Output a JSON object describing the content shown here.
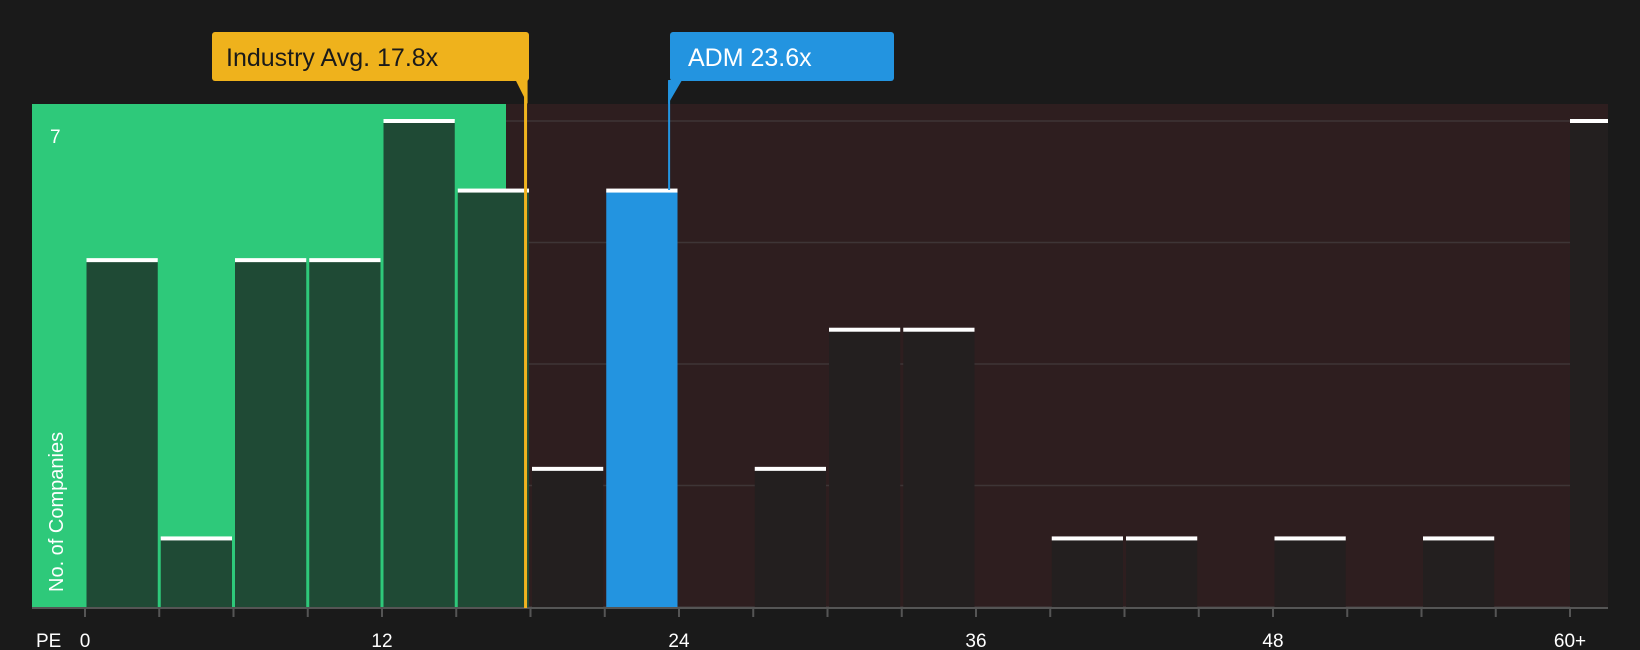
{
  "chart_data": {
    "type": "bar",
    "x_axis_label": "PE",
    "y_axis_label": "No. of Companies",
    "y_tick_label": "7",
    "ylim": [
      0,
      7
    ],
    "bin_width": 3,
    "xlim": [
      0,
      60
    ],
    "x_tick_values": [
      0,
      12,
      24,
      36,
      48
    ],
    "x_tick_labels": [
      "0",
      "12",
      "24",
      "36",
      "48",
      "60+"
    ],
    "bins": [
      {
        "start": 0,
        "value": 5
      },
      {
        "start": 3,
        "value": 1
      },
      {
        "start": 6,
        "value": 5
      },
      {
        "start": 9,
        "value": 5
      },
      {
        "start": 12,
        "value": 7
      },
      {
        "start": 15,
        "value": 6
      },
      {
        "start": 18,
        "value": 2
      },
      {
        "start": 21,
        "value": 6,
        "highlight": true
      },
      {
        "start": 24,
        "value": 0
      },
      {
        "start": 27,
        "value": 2
      },
      {
        "start": 30,
        "value": 4
      },
      {
        "start": 33,
        "value": 4
      },
      {
        "start": 36,
        "value": 0
      },
      {
        "start": 39,
        "value": 1
      },
      {
        "start": 42,
        "value": 1
      },
      {
        "start": 45,
        "value": 0
      },
      {
        "start": 48,
        "value": 1
      },
      {
        "start": 51,
        "value": 0
      },
      {
        "start": 54,
        "value": 1
      },
      {
        "start": 57,
        "value": 0
      },
      {
        "start": 60,
        "value": 7
      }
    ],
    "industry_avg": {
      "value": 17.8,
      "label": "Industry Avg. 17.8x"
    },
    "company": {
      "name": "ADM",
      "value": 23.6,
      "label": "ADM 23.6x"
    },
    "colors": {
      "background": "#1a1a1a",
      "below_avg_zone": "#2ec97a",
      "above_avg_zone": "#2e1e1f",
      "bar_in_green": "#1f4a35",
      "bar_in_red": "#231f1f",
      "highlight_bar": "#2394e0",
      "avg_line": "#f0b31f",
      "avg_callout": "#efb21c",
      "company_callout": "#2394e0",
      "bar_cap": "#ffffff",
      "gridline": "#3e3536",
      "axis": "#555555"
    }
  }
}
